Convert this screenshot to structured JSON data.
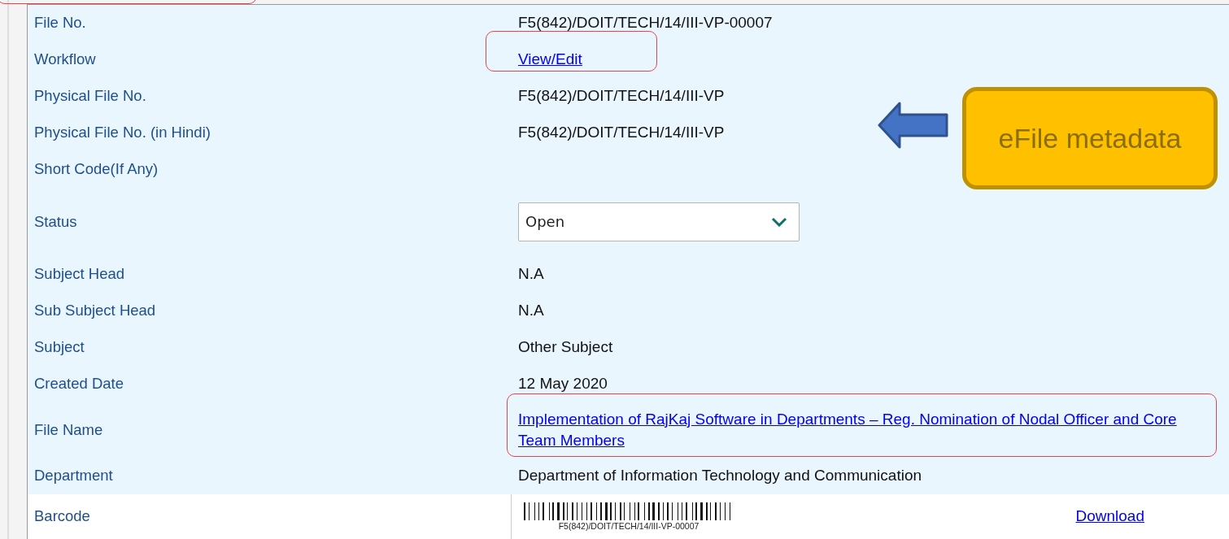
{
  "rows": [
    {
      "label": "File No.",
      "kind": "text",
      "value": "F5(842)/DOIT/TECH/14/III-VP-00007"
    },
    {
      "label": "Workflow",
      "kind": "link",
      "value": "View/Edit"
    },
    {
      "label": "Physical File No.",
      "kind": "text",
      "value": "F5(842)/DOIT/TECH/14/III-VP"
    },
    {
      "label": "Physical File No. (in Hindi)",
      "kind": "text",
      "value": "F5(842)/DOIT/TECH/14/III-VP"
    },
    {
      "label": "Short Code(If Any)",
      "kind": "text"
    },
    {
      "label": "Status",
      "kind": "select",
      "value": "Open"
    },
    {
      "label": "Subject Head",
      "kind": "text",
      "value": "N.A"
    },
    {
      "label": "Sub Subject Head",
      "kind": "text",
      "value": "N.A"
    },
    {
      "label": "Subject",
      "kind": "text",
      "value": "Other Subject"
    },
    {
      "label": "Created Date",
      "kind": "text",
      "value": "12 May 2020"
    },
    {
      "label": "File Name",
      "kind": "link",
      "value": "Implementation of RajKaj Software in Departments – Reg. Nomination of Nodal Officer and Core Team Members"
    },
    {
      "label": "Department",
      "kind": "text",
      "value": "Department of Information Technology and Communication"
    },
    {
      "label": "Barcode",
      "kind": "barcode",
      "value": "F5(842)/DOIT/TECH/14/III-VP-00007",
      "action": "Download"
    }
  ],
  "callout": {
    "text": "eFile metadata"
  }
}
